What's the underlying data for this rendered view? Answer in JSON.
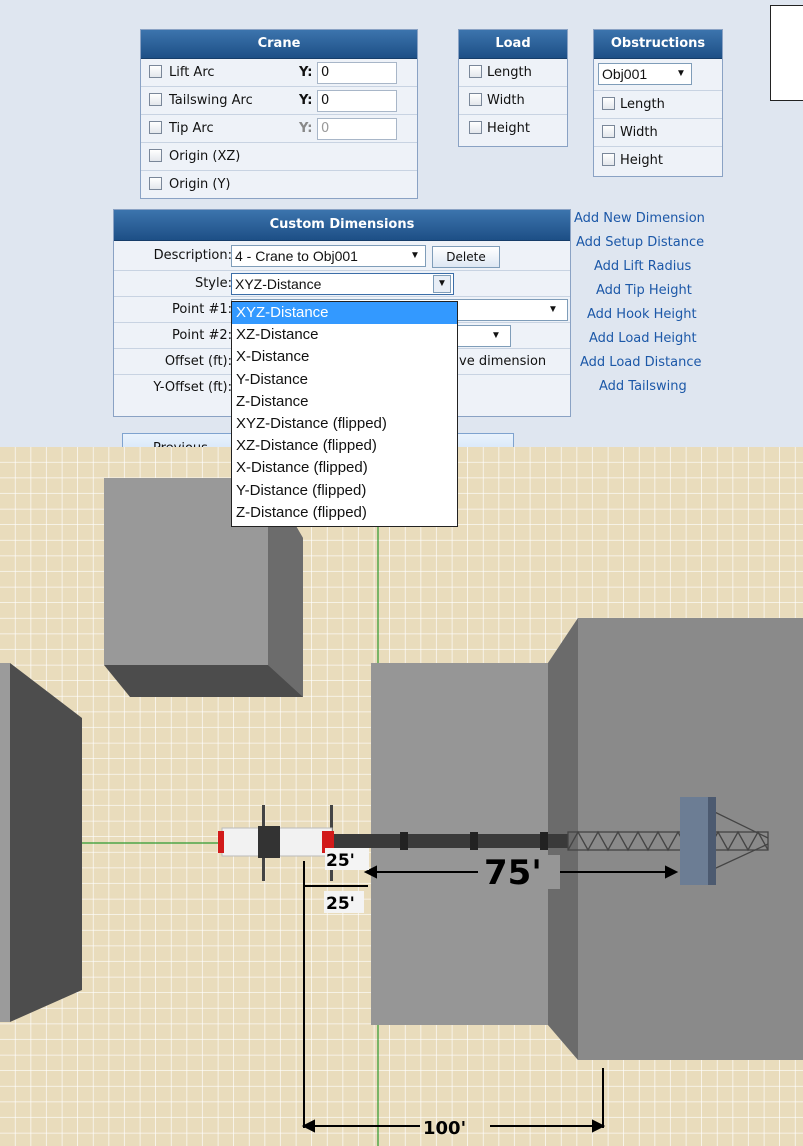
{
  "crane_panel": {
    "title": "Crane",
    "rows": [
      {
        "label": "Lift Arc",
        "y_label": "Y:",
        "y_value": "0"
      },
      {
        "label": "Tailswing Arc",
        "y_label": "Y:",
        "y_value": "0"
      },
      {
        "label": "Tip Arc",
        "y_label": "Y:",
        "y_value": "0"
      },
      {
        "label": "Origin (XZ)"
      },
      {
        "label": "Origin (Y)"
      }
    ]
  },
  "load_panel": {
    "title": "Load",
    "rows": [
      {
        "label": "Length"
      },
      {
        "label": "Width"
      },
      {
        "label": "Height"
      }
    ]
  },
  "obstructions_panel": {
    "title": "Obstructions",
    "selected": "Obj001",
    "rows": [
      {
        "label": "Length"
      },
      {
        "label": "Width"
      },
      {
        "label": "Height"
      }
    ]
  },
  "custom_dimensions": {
    "title": "Custom Dimensions",
    "description_label": "Description:",
    "description_value": "4 - Crane to Obj001",
    "delete_label": "Delete",
    "style_label": "Style:",
    "style_value": "XYZ-Distance",
    "point1_label": "Point #1:",
    "point2_label": "Point #2:",
    "offset_label": "Offset (ft):",
    "yoffset_label": "Y-Offset (ft):",
    "save_partial": "ve dimension",
    "previous_label": "Previous"
  },
  "style_options": [
    "XYZ-Distance",
    "XZ-Distance",
    "X-Distance",
    "Y-Distance",
    "Z-Distance",
    "XYZ-Distance (flipped)",
    "XZ-Distance (flipped)",
    "X-Distance (flipped)",
    "Y-Distance (flipped)",
    "Z-Distance (flipped)"
  ],
  "add_links": [
    "Add New Dimension",
    "Add Setup Distance",
    "Add Lift Radius",
    "Add Tip Height",
    "Add Hook Height",
    "Add Load Height",
    "Add Load Distance",
    "Add Tailswing"
  ],
  "scene": {
    "dim_25a": "25'",
    "dim_25b": "25'",
    "dim_75": "75'",
    "dim_100": "100'"
  },
  "colors": {
    "header": "#1d4f86",
    "link": "#1c58a8",
    "grid_bg": "#e8dcbc",
    "grid_line": "#ffffff",
    "highlight": "#3399ff"
  }
}
